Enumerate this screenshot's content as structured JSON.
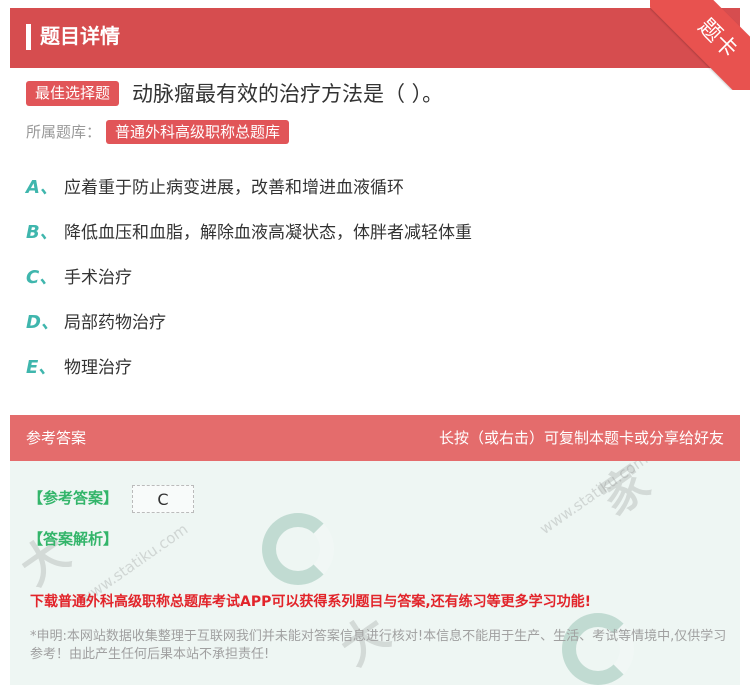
{
  "header": {
    "title": "题目详情",
    "corner_label": "题卡"
  },
  "question": {
    "type_badge": "最佳选择题",
    "text": "动脉瘤最有效的治疗方法是（ ）。",
    "bank_label": "所属题库：",
    "bank_name": "普通外科高级职称总题库"
  },
  "options": [
    {
      "letter": "A、",
      "text": "应着重于防止病变进展，改善和增进血液循环"
    },
    {
      "letter": "B、",
      "text": "降低血压和血脂，解除血液高凝状态，体胖者减轻体重"
    },
    {
      "letter": "C、",
      "text": "手术治疗"
    },
    {
      "letter": "D、",
      "text": "局部药物治疗"
    },
    {
      "letter": "E、",
      "text": "物理治疗"
    }
  ],
  "answer": {
    "header_left": "参考答案",
    "header_right": "长按（或右击）可复制本题卡或分享给好友",
    "ref_label": "【参考答案】",
    "ref_value": "C",
    "analysis_label": "【答案解析】",
    "download_text": "下载普通外科高级职称总题库考试APP可以获得系列题目与答案,还有练习等更多学习功能!",
    "disclaimer": "*申明:本网站数据收集整理于互联网我们并未能对答案信息进行核对!本信息不能用于生产、生活、考试等情境中,仅供学习参考！由此产生任何后果本站不承担责任!"
  },
  "colors": {
    "header_red": "#d64d4f",
    "badge_red": "#e15558",
    "option_letter": "#3fb6ad",
    "answer_label_green": "#33b56a",
    "download_red": "#e2242a"
  }
}
